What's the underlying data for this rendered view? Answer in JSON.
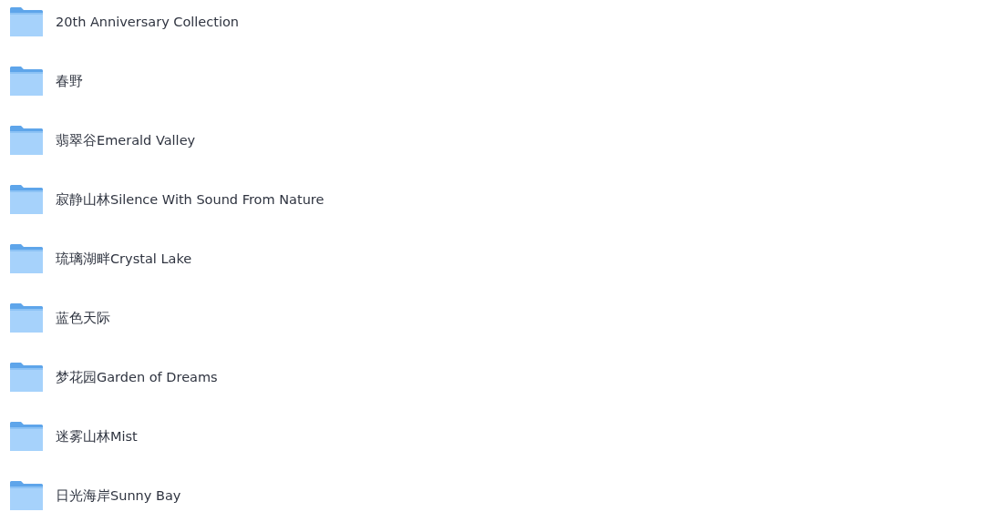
{
  "folders": [
    {
      "name": "20th Anniversary Collection"
    },
    {
      "name": "春野"
    },
    {
      "name": "翡翠谷Emerald Valley"
    },
    {
      "name": "寂静山林Silence With Sound From Nature"
    },
    {
      "name": "琉璃湖畔Crystal Lake"
    },
    {
      "name": "蓝色天际"
    },
    {
      "name": "梦花园Garden of Dreams"
    },
    {
      "name": "迷雾山林Mist"
    },
    {
      "name": "日光海岸Sunny Bay"
    }
  ]
}
